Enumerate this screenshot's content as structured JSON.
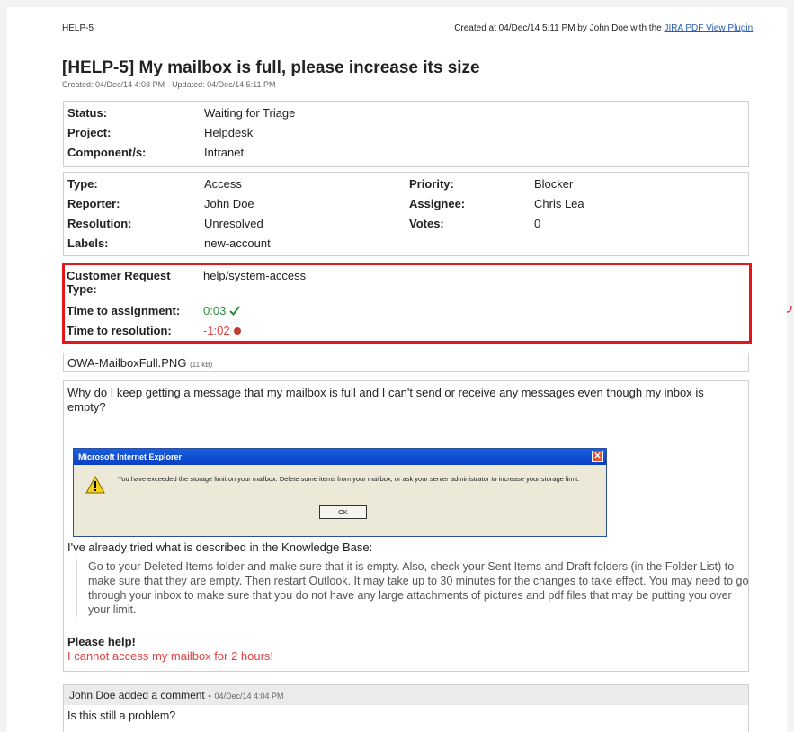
{
  "header": {
    "issue_key": "HELP-5",
    "created_prefix": "Created at 04/Dec/14 5:11 PM by John Doe with the ",
    "plugin_link": "JIRA PDF View Plugin",
    "created_suffix": "."
  },
  "issue": {
    "title": "[HELP-5] My mailbox is full, please increase its size",
    "subtitle": "Created: 04/Dec/14 4:03 PM - Updated: 04/Dec/14 5:11 PM"
  },
  "summary_fields": [
    {
      "label": "Status:",
      "value": "Waiting for Triage"
    },
    {
      "label": "Project:",
      "value": "Helpdesk"
    },
    {
      "label": "Component/s:",
      "value": "Intranet"
    }
  ],
  "detail_fields": {
    "left": [
      {
        "label": "Type:",
        "value": "Access"
      },
      {
        "label": "Reporter:",
        "value": "John Doe"
      },
      {
        "label": "Resolution:",
        "value": "Unresolved"
      },
      {
        "label": "Labels:",
        "value": "new-account"
      }
    ],
    "right": [
      {
        "label": "Priority:",
        "value": "Blocker"
      },
      {
        "label": "Assignee:",
        "value": "Chris Lea"
      },
      {
        "label": "Votes:",
        "value": "0"
      }
    ]
  },
  "service_desk": {
    "request_type_label": "Customer Request Type:",
    "request_type_value": "help/system-access",
    "assignment_label": "Time to assignment:",
    "assignment_value": "0:03",
    "resolution_label": "Time to resolution:",
    "resolution_value": "-1:02"
  },
  "attachment": {
    "name": "OWA-MailboxFull.PNG",
    "size": "(11 kB)"
  },
  "description": {
    "question": "Why do I keep getting a message that my mailbox is full and I can't send or receive any messages even though my inbox is empty?",
    "dialog_title": "Microsoft Internet Explorer",
    "dialog_message": "You have exceeded the storage limit on your mailbox. Delete some items from your mailbox, or ask your server administrator to increase your storage limit.",
    "dialog_ok": "OK",
    "kb_intro": "I've already tried what is described in the Knowledge Base:",
    "kb_quote": "Go to your Deleted Items folder and make sure that it is empty. Also, check your Sent Items and Draft folders (in the Folder List) to make sure that they are empty. Then restart Outlook. It may take up to 30 minutes for the changes to take effect. You may need to go through your inbox to make sure that you do not have any large attachments of pictures and pdf files that may be putting you over your limit.",
    "please_help": "Please help!",
    "urgent": "I cannot access my mailbox for 2 hours!"
  },
  "comment": {
    "author_action": "John Doe added a comment - ",
    "timestamp": "04/Dec/14 4:04 PM",
    "body": "Is this still a problem?"
  },
  "colors": {
    "highlight_border": "#e6151b",
    "sla_ok": "#2e8b3a",
    "sla_breached": "#e04040",
    "link": "#2a5db0"
  }
}
